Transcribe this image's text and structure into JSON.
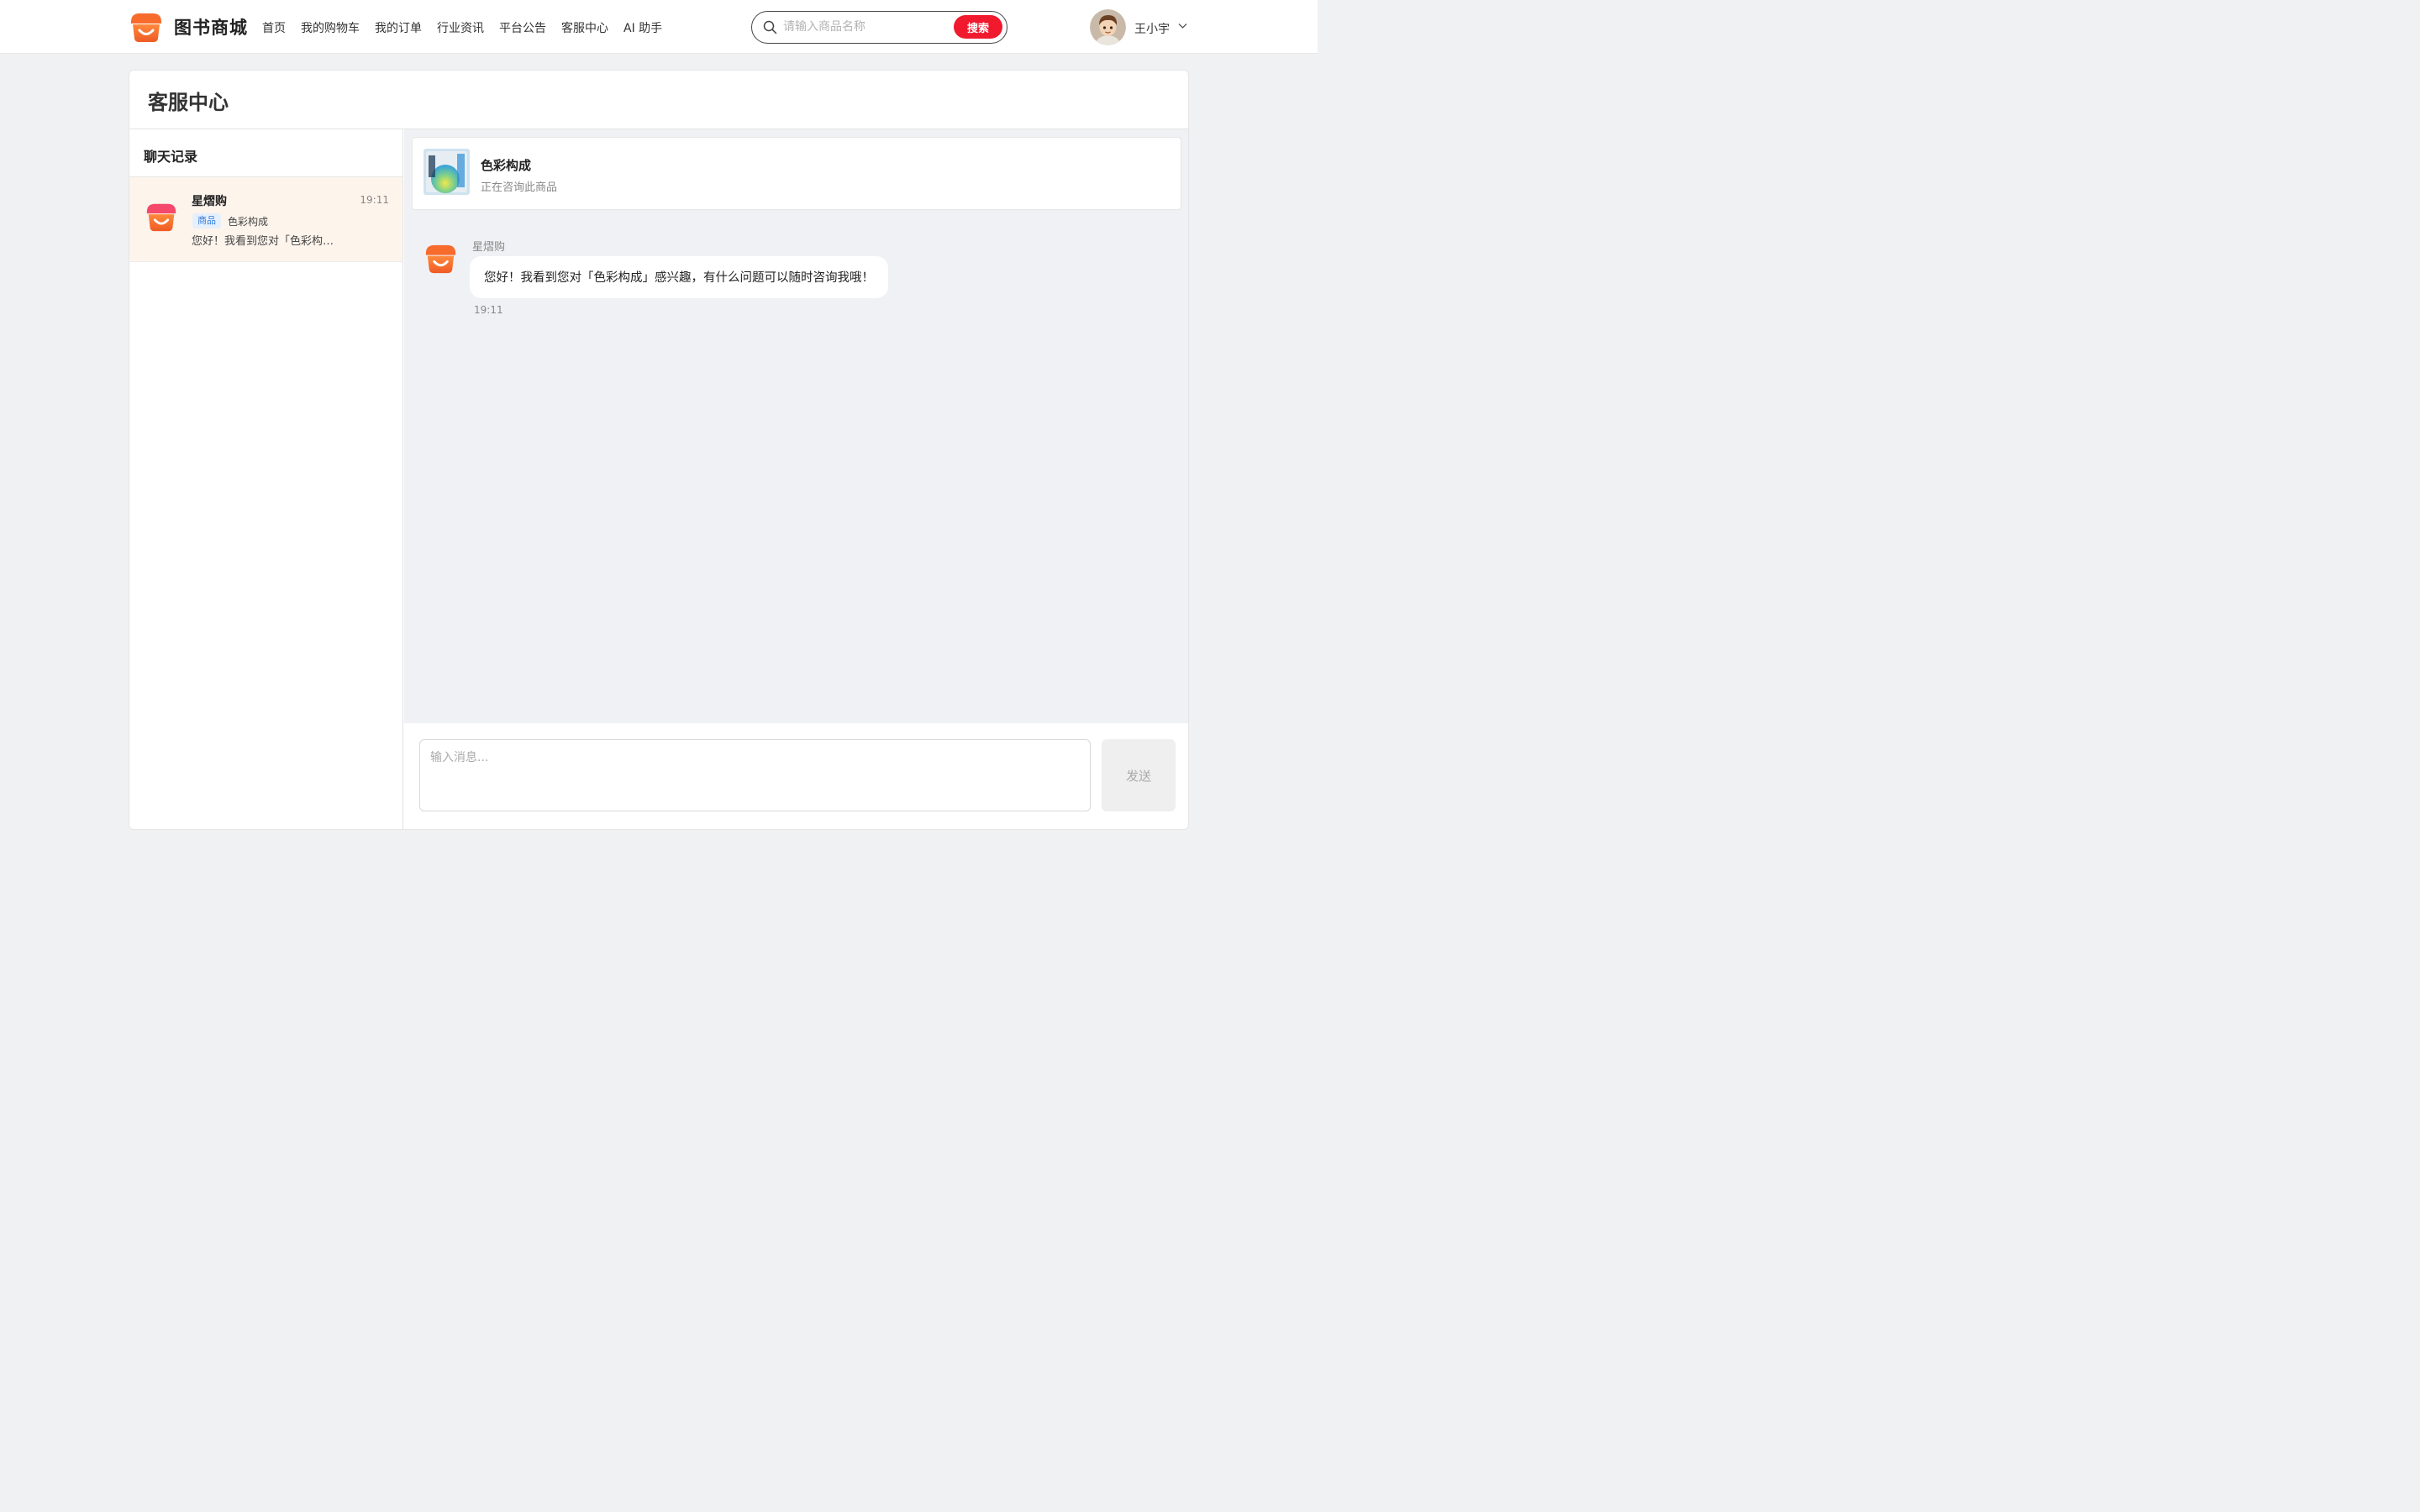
{
  "brand": {
    "name": "图书商城",
    "logo_icon": "shop-logo-icon",
    "accent": "#f0192e"
  },
  "nav": {
    "items": [
      {
        "label": "首页"
      },
      {
        "label": "我的购物车"
      },
      {
        "label": "我的订单"
      },
      {
        "label": "行业资讯"
      },
      {
        "label": "平台公告"
      },
      {
        "label": "客服中心"
      },
      {
        "label": "AI 助手"
      }
    ]
  },
  "search": {
    "placeholder": "请输入商品名称",
    "value": "",
    "button_label": "搜索"
  },
  "user": {
    "name": "王小宇"
  },
  "page": {
    "title": "客服中心"
  },
  "sidebar": {
    "title": "聊天记录",
    "conversations": [
      {
        "name": "星熠购",
        "time": "19:11",
        "tag": "商品",
        "product": "色彩构成",
        "preview": "您好！我看到您对「色彩构…"
      }
    ]
  },
  "chat": {
    "product_card": {
      "name": "色彩构成",
      "subtitle": "正在咨询此商品"
    },
    "messages": [
      {
        "sender": "星熠购",
        "text": "您好！我看到您对「色彩构成」感兴趣，有什么问题可以随时咨询我哦！",
        "time": "19:11"
      }
    ],
    "composer": {
      "placeholder": "输入消息...",
      "value": "",
      "send_label": "发送"
    }
  }
}
